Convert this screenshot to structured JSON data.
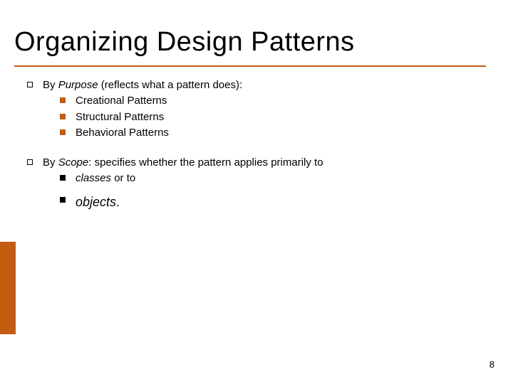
{
  "title": "Organizing Design Patterns",
  "group1": {
    "lead_prefix": "By ",
    "lead_emph": "Purpose",
    "lead_suffix": " (reflects what a pattern does):",
    "items": [
      "Creational Patterns",
      "Structural Patterns",
      "Behavioral Patterns"
    ]
  },
  "group2": {
    "lead_prefix": "By ",
    "lead_emph": "Scope",
    "lead_suffix": ": specifies whether the pattern applies primarily to",
    "item1_emph": "classes",
    "item1_suffix": " or to",
    "item2_emph": "objects",
    "item2_suffix": "."
  },
  "page_number": "8",
  "colors": {
    "accent": "#c55a11"
  }
}
